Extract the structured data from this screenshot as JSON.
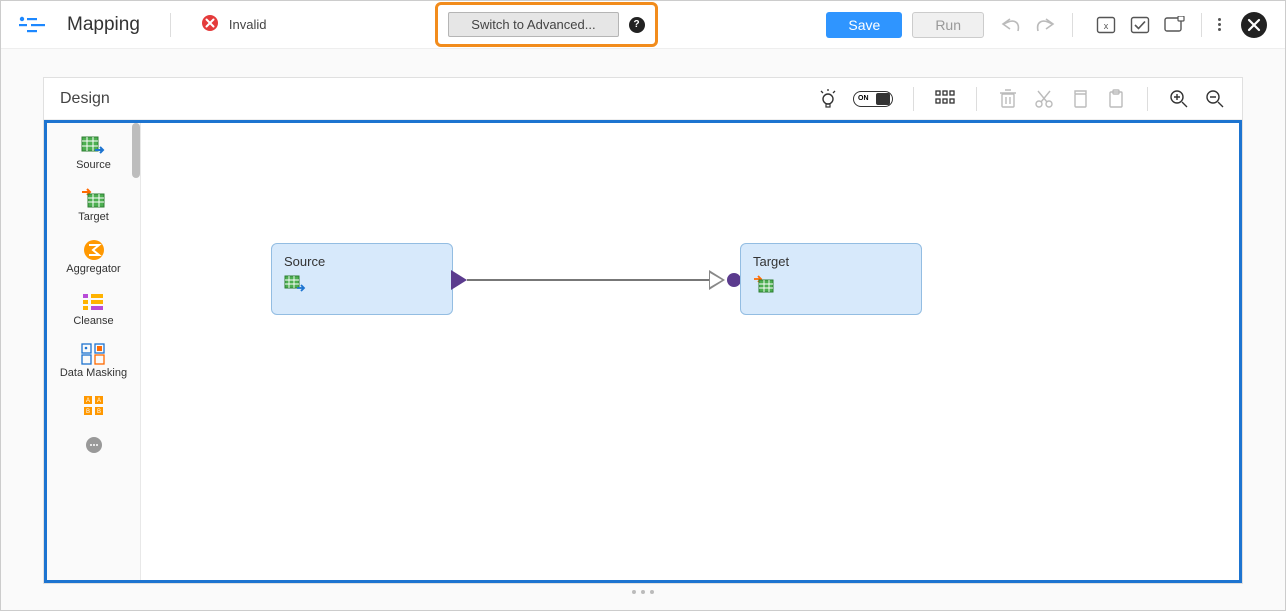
{
  "header": {
    "title": "Mapping",
    "status": {
      "icon": "error-icon",
      "label": "Invalid"
    },
    "switch_button": "Switch to Advanced...",
    "save_label": "Save",
    "run_label": "Run"
  },
  "design": {
    "title": "Design",
    "toggle_label": "ON",
    "palette": [
      {
        "key": "source",
        "label": "Source"
      },
      {
        "key": "target",
        "label": "Target"
      },
      {
        "key": "aggregator",
        "label": "Aggregator"
      },
      {
        "key": "cleanse",
        "label": "Cleanse"
      },
      {
        "key": "datamasking",
        "label": "Data Masking"
      }
    ],
    "nodes": {
      "source": {
        "label": "Source"
      },
      "target": {
        "label": "Target"
      }
    }
  },
  "colors": {
    "accent": "#2f95ff",
    "highlight": "#f28c1c",
    "design_border": "#1d74d0",
    "node_bg": "#d7e9fb",
    "node_border": "#93bde2",
    "flow_accent": "#5b3b8e"
  }
}
